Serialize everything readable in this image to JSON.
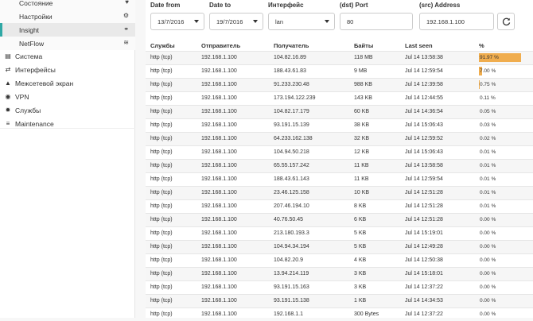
{
  "sidebar": {
    "items": [
      {
        "label": "Состояние",
        "icon": "heartbeat-icon",
        "glyph": "♥",
        "kind": "sub",
        "active": false
      },
      {
        "label": "Настройки",
        "icon": "gear-icon",
        "glyph": "⚙",
        "kind": "sub",
        "active": false
      },
      {
        "label": "Insight",
        "icon": "binoculars-icon",
        "glyph": "⚭",
        "kind": "sub",
        "active": true
      },
      {
        "label": "NetFlow",
        "icon": "rss-icon",
        "glyph": "≋",
        "kind": "sub",
        "active": false
      },
      {
        "label": "Система",
        "icon": "server-icon",
        "glyph": "▤",
        "kind": "top",
        "active": false
      },
      {
        "label": "Интерфейсы",
        "icon": "network-icon",
        "glyph": "⇄",
        "kind": "top",
        "active": false
      },
      {
        "label": "Межсетевой экран",
        "icon": "fire-icon",
        "glyph": "▲",
        "kind": "top",
        "active": false
      },
      {
        "label": "VPN",
        "icon": "globe-icon",
        "glyph": "◉",
        "kind": "top",
        "active": false
      },
      {
        "label": "Службы",
        "icon": "cog-icon",
        "glyph": "✹",
        "kind": "top",
        "active": false
      },
      {
        "label": "Maintenance",
        "icon": "sliders-icon",
        "glyph": "≡",
        "kind": "top",
        "active": false
      }
    ]
  },
  "filters": {
    "date_from": {
      "label": "Date from",
      "value": "13/7/2016"
    },
    "date_to": {
      "label": "Date to",
      "value": "19/7/2016"
    },
    "interface": {
      "label": "Интерфейс",
      "value": "lan"
    },
    "dst_port": {
      "label": "(dst) Port",
      "value": "80"
    },
    "src_address": {
      "label": "(src) Address",
      "value": "192.168.1.100"
    }
  },
  "table": {
    "headers": [
      "Службы",
      "Отправитель",
      "Получатель",
      "Байты",
      "Last seen",
      "%"
    ],
    "rows": [
      {
        "service": "http (tcp)",
        "src": "192.168.1.100",
        "dst": "104.82.16.89",
        "bytes": "118 MB",
        "last_seen": "Jul 14 13:58:38",
        "pct": "91.97 %",
        "pct_value": 91.97
      },
      {
        "service": "http (tcp)",
        "src": "192.168.1.100",
        "dst": "188.43.61.83",
        "bytes": "9 MB",
        "last_seen": "Jul 14 12:59:54",
        "pct": "7.00 %",
        "pct_value": 7.0
      },
      {
        "service": "http (tcp)",
        "src": "192.168.1.100",
        "dst": "91.233.230.48",
        "bytes": "988 KB",
        "last_seen": "Jul 14 12:39:58",
        "pct": "0.75 %",
        "pct_value": 0.75
      },
      {
        "service": "http (tcp)",
        "src": "192.168.1.100",
        "dst": "173.194.122.239",
        "bytes": "143 KB",
        "last_seen": "Jul 14 12:44:55",
        "pct": "0.11 %",
        "pct_value": 0.11
      },
      {
        "service": "http (tcp)",
        "src": "192.168.1.100",
        "dst": "104.82.17.179",
        "bytes": "60 KB",
        "last_seen": "Jul 14 14:36:54",
        "pct": "0.05 %",
        "pct_value": 0.05
      },
      {
        "service": "http (tcp)",
        "src": "192.168.1.100",
        "dst": "93.191.15.139",
        "bytes": "38 KB",
        "last_seen": "Jul 14 15:06:43",
        "pct": "0.03 %",
        "pct_value": 0.03
      },
      {
        "service": "http (tcp)",
        "src": "192.168.1.100",
        "dst": "64.233.162.138",
        "bytes": "32 KB",
        "last_seen": "Jul 14 12:59:52",
        "pct": "0.02 %",
        "pct_value": 0.02
      },
      {
        "service": "http (tcp)",
        "src": "192.168.1.100",
        "dst": "104.94.50.218",
        "bytes": "12 KB",
        "last_seen": "Jul 14 15:06:43",
        "pct": "0.01 %",
        "pct_value": 0.01
      },
      {
        "service": "http (tcp)",
        "src": "192.168.1.100",
        "dst": "65.55.157.242",
        "bytes": "11 KB",
        "last_seen": "Jul 14 13:58:58",
        "pct": "0.01 %",
        "pct_value": 0.01
      },
      {
        "service": "http (tcp)",
        "src": "192.168.1.100",
        "dst": "188.43.61.143",
        "bytes": "11 KB",
        "last_seen": "Jul 14 12:59:54",
        "pct": "0.01 %",
        "pct_value": 0.01
      },
      {
        "service": "http (tcp)",
        "src": "192.168.1.100",
        "dst": "23.46.125.158",
        "bytes": "10 KB",
        "last_seen": "Jul 14 12:51:28",
        "pct": "0.01 %",
        "pct_value": 0.01
      },
      {
        "service": "http (tcp)",
        "src": "192.168.1.100",
        "dst": "207.46.194.10",
        "bytes": "8 KB",
        "last_seen": "Jul 14 12:51:28",
        "pct": "0.01 %",
        "pct_value": 0.01
      },
      {
        "service": "http (tcp)",
        "src": "192.168.1.100",
        "dst": "40.76.50.45",
        "bytes": "6 KB",
        "last_seen": "Jul 14 12:51:28",
        "pct": "0.00 %",
        "pct_value": 0.0
      },
      {
        "service": "http (tcp)",
        "src": "192.168.1.100",
        "dst": "213.180.193.3",
        "bytes": "5 KB",
        "last_seen": "Jul 14 15:19:01",
        "pct": "0.00 %",
        "pct_value": 0.0
      },
      {
        "service": "http (tcp)",
        "src": "192.168.1.100",
        "dst": "104.94.34.194",
        "bytes": "5 KB",
        "last_seen": "Jul 14 12:49:28",
        "pct": "0.00 %",
        "pct_value": 0.0
      },
      {
        "service": "http (tcp)",
        "src": "192.168.1.100",
        "dst": "104.82.20.9",
        "bytes": "4 KB",
        "last_seen": "Jul 14 12:50:38",
        "pct": "0.00 %",
        "pct_value": 0.0
      },
      {
        "service": "http (tcp)",
        "src": "192.168.1.100",
        "dst": "13.94.214.119",
        "bytes": "3 KB",
        "last_seen": "Jul 14 15:18:01",
        "pct": "0.00 %",
        "pct_value": 0.0
      },
      {
        "service": "http (tcp)",
        "src": "192.168.1.100",
        "dst": "93.191.15.163",
        "bytes": "3 KB",
        "last_seen": "Jul 14 12:37:22",
        "pct": "0.00 %",
        "pct_value": 0.0
      },
      {
        "service": "http (tcp)",
        "src": "192.168.1.100",
        "dst": "93.191.15.138",
        "bytes": "1 KB",
        "last_seen": "Jul 14 14:34:53",
        "pct": "0.00 %",
        "pct_value": 0.0
      },
      {
        "service": "http (tcp)",
        "src": "192.168.1.100",
        "dst": "192.168.1.1",
        "bytes": "300 Bytes",
        "last_seen": "Jul 14 12:37:22",
        "pct": "0.00 %",
        "pct_value": 0.0
      }
    ]
  },
  "colors": {
    "bar": "#f0ad4e",
    "active_accent": "#2fa8a5"
  }
}
